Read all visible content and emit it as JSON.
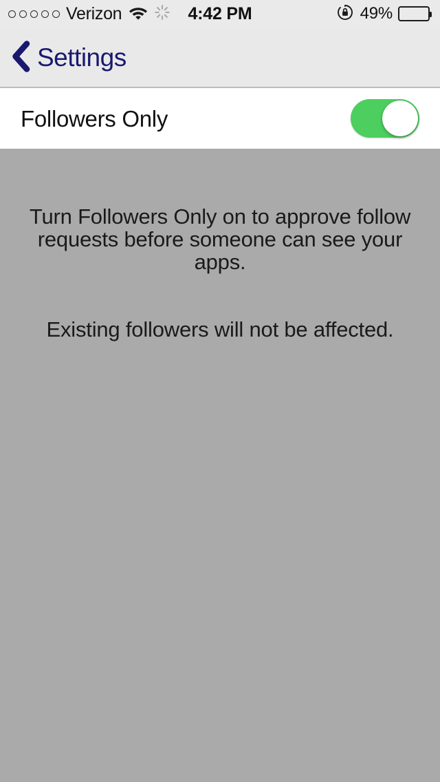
{
  "status_bar": {
    "signal_dots": 5,
    "signal_filled": 0,
    "carrier": "Verizon",
    "wifi_icon": "wifi-icon",
    "activity_icon": "activity-spinner-icon",
    "time": "4:42 PM",
    "rotation_lock_icon": "rotation-lock-icon",
    "battery_percent": "49%",
    "battery_level": 49
  },
  "nav_bar": {
    "back_icon": "chevron-left-icon",
    "back_label": "Settings"
  },
  "settings_row": {
    "label": "Followers Only",
    "toggle_state": "on",
    "toggle_on_color": "#4ccf5f"
  },
  "footer_text": {
    "paragraph_1": "Turn Followers Only on to approve follow requests before someone can see your apps.",
    "paragraph_2": "Existing followers will not be affected."
  },
  "colors": {
    "status_bar_bg": "#eaeaea",
    "nav_bar_bg": "#e9e9e9",
    "row_bg": "#ffffff",
    "content_bg": "#aaaaaa",
    "accent": "#191970",
    "toggle_green": "#4ccf5f"
  }
}
